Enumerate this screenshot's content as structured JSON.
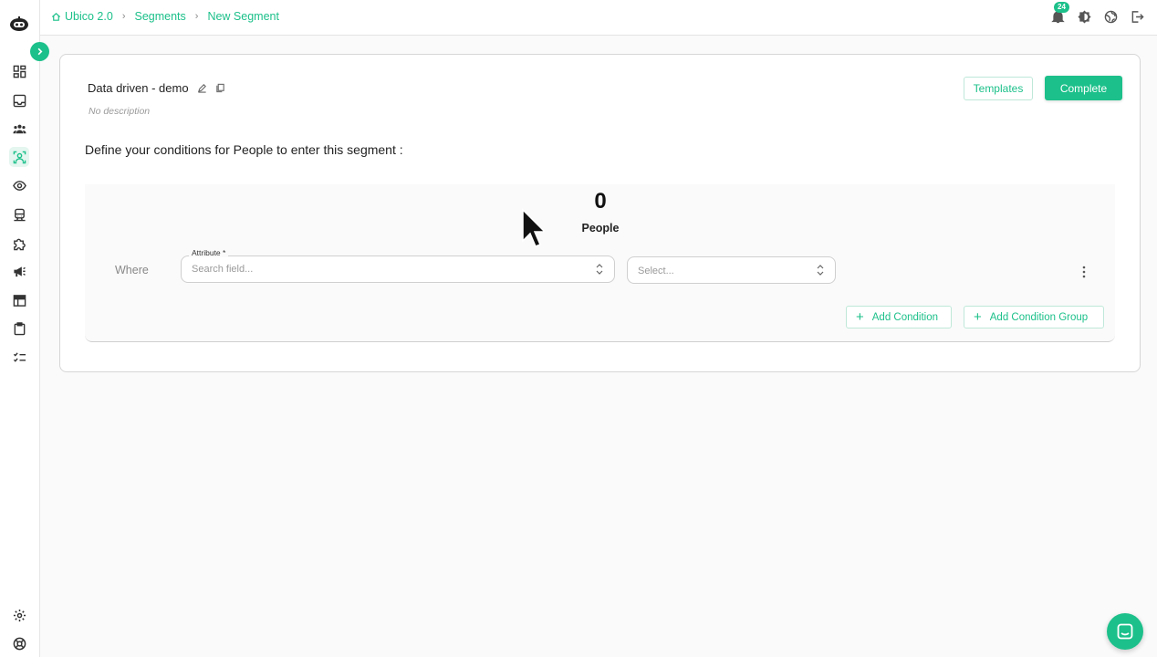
{
  "breadcrumb": {
    "items": [
      "Ubico 2.0",
      "Segments",
      "New Segment"
    ]
  },
  "notifications": {
    "count": "24"
  },
  "segment": {
    "name": "Data driven - demo",
    "description": "No description"
  },
  "actions": {
    "templates_label": "Templates",
    "complete_label": "Complete"
  },
  "conditions": {
    "heading": "Define your conditions for People to enter this segment :",
    "count": "0",
    "count_label": "People",
    "where_label": "Where",
    "attribute_label": "Attribute *",
    "attribute_placeholder": "Search field...",
    "operator_placeholder": "Select...",
    "add_condition_label": "Add Condition",
    "add_condition_group_label": "Add Condition Group"
  },
  "colors": {
    "accent": "#1cc08a",
    "text": "#222222",
    "muted": "#9a9a9a"
  },
  "sidebar_icons": [
    "dashboard-icon",
    "inbox-icon",
    "people-icon",
    "segments-icon",
    "eye-icon",
    "train-icon",
    "puzzle-icon",
    "megaphone-icon",
    "table-icon",
    "clipboard-icon",
    "checklist-icon",
    "settings-icon",
    "help-icon"
  ]
}
